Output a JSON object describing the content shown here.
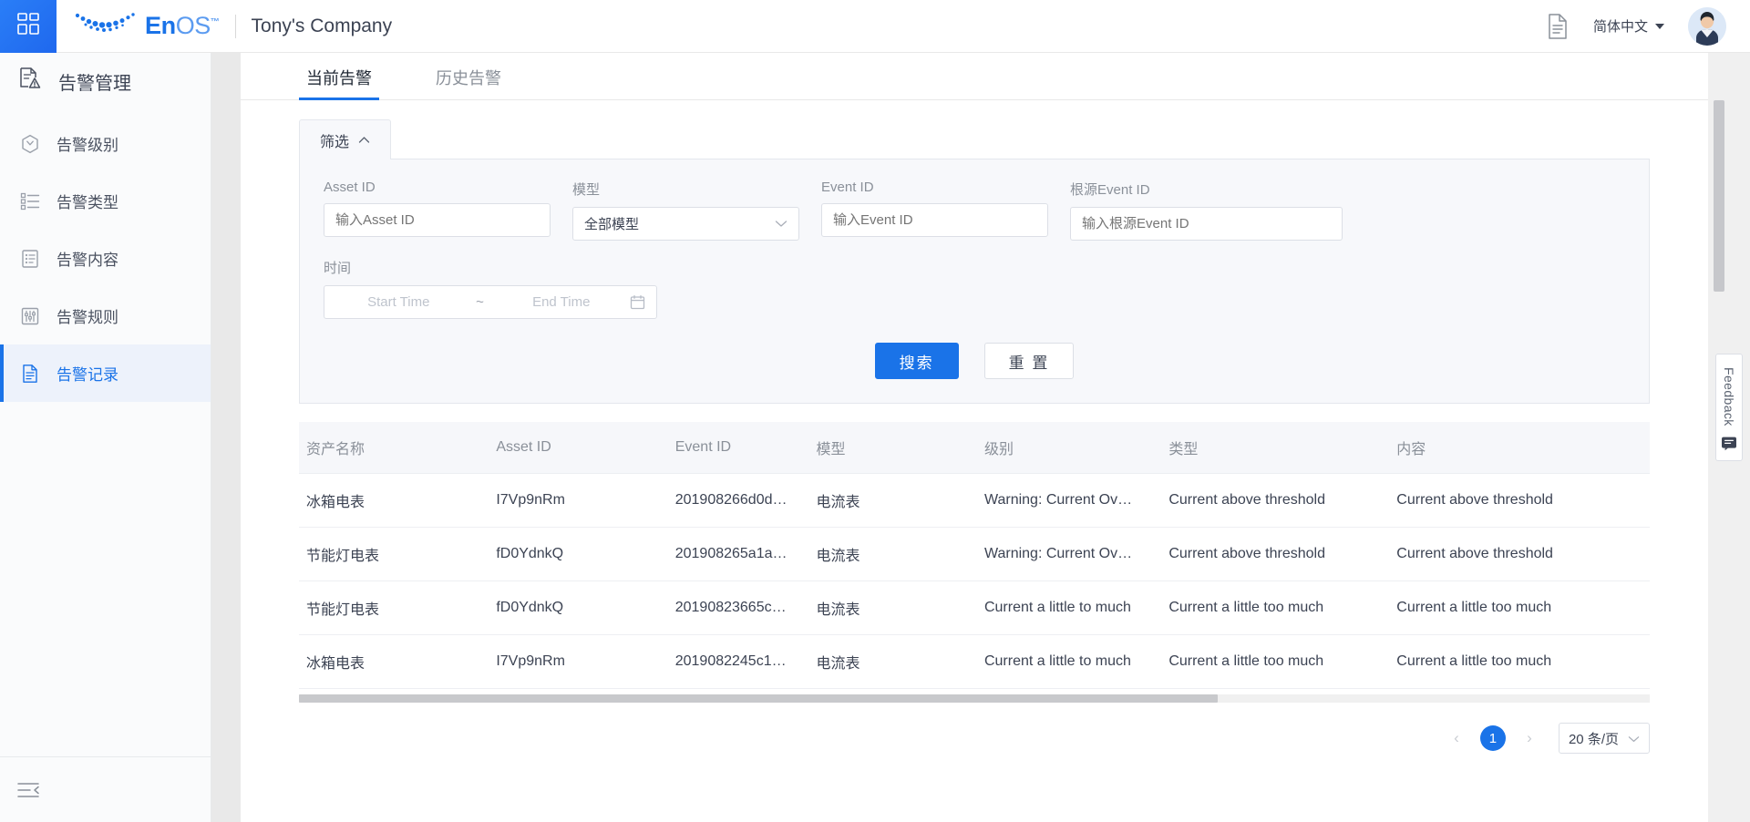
{
  "header": {
    "launcher_icon": "app-grid-icon",
    "logo_text_en": "En",
    "logo_text_os": "OS",
    "logo_tm": "™",
    "company": "Tony's Company",
    "doc_icon": "document-icon",
    "language": "简体中文",
    "avatar_alt": "user-avatar"
  },
  "sidebar": {
    "title": "告警管理",
    "title_icon": "alert-document-icon",
    "items": [
      {
        "label": "告警级别",
        "icon": "hexagon-level-icon",
        "active": false
      },
      {
        "label": "告警类型",
        "icon": "list-type-icon",
        "active": false
      },
      {
        "label": "告警内容",
        "icon": "clipboard-content-icon",
        "active": false
      },
      {
        "label": "告警规则",
        "icon": "sliders-rule-icon",
        "active": false
      },
      {
        "label": "告警记录",
        "icon": "file-record-icon",
        "active": true
      }
    ],
    "collapse_icon": "collapse-sidebar-icon"
  },
  "tabs": [
    {
      "label": "当前告警",
      "active": true
    },
    {
      "label": "历史告警",
      "active": false
    }
  ],
  "filter": {
    "tab_label": "筛选",
    "tab_chevron": "chevron-up-icon",
    "fields": {
      "asset_id": {
        "label": "Asset ID",
        "placeholder": "输入Asset ID",
        "value": ""
      },
      "model": {
        "label": "模型",
        "value": "全部模型",
        "chevron": "chevron-down-icon"
      },
      "event_id": {
        "label": "Event ID",
        "placeholder": "输入Event ID",
        "value": ""
      },
      "root_event_id": {
        "label": "根源Event ID",
        "placeholder": "输入根源Event ID",
        "value": ""
      },
      "time": {
        "label": "时间",
        "start_placeholder": "Start Time",
        "separator": "~",
        "end_placeholder": "End Time",
        "calendar_icon": "calendar-icon"
      }
    },
    "search_label": "搜索",
    "reset_label": "重 置"
  },
  "table": {
    "columns": [
      "资产名称",
      "Asset ID",
      "Event ID",
      "模型",
      "级别",
      "类型",
      "内容"
    ],
    "rows": [
      {
        "asset_name": "冰箱电表",
        "asset_id": "I7Vp9nRm",
        "event_id": "201908266d0d…",
        "model": "电流表",
        "level": "Warning: Current Ov…",
        "type": "Current above threshold",
        "content": "Current above threshold"
      },
      {
        "asset_name": "节能灯电表",
        "asset_id": "fD0YdnkQ",
        "event_id": "201908265a1a…",
        "model": "电流表",
        "level": "Warning: Current Ov…",
        "type": "Current above threshold",
        "content": "Current above threshold"
      },
      {
        "asset_name": "节能灯电表",
        "asset_id": "fD0YdnkQ",
        "event_id": "20190823665c…",
        "model": "电流表",
        "level": "Current a little to much",
        "type": "Current a little too much",
        "content": "Current a little too much"
      },
      {
        "asset_name": "冰箱电表",
        "asset_id": "I7Vp9nRm",
        "event_id": "2019082245c1…",
        "model": "电流表",
        "level": "Current a little to much",
        "type": "Current a little too much",
        "content": "Current a little too much"
      }
    ]
  },
  "pagination": {
    "prev": "‹",
    "current_page": "1",
    "next": "›",
    "page_size": "20 条/页",
    "page_size_chevron": "chevron-down-icon"
  },
  "feedback": {
    "label": "Feedback",
    "icon": "feedback-chat-icon"
  },
  "colors": {
    "accent": "#1a73e8",
    "text": "#3c4353",
    "muted": "#8a9099",
    "panel_bg": "#f7f8fb",
    "page_bg": "#e9e9e9"
  }
}
